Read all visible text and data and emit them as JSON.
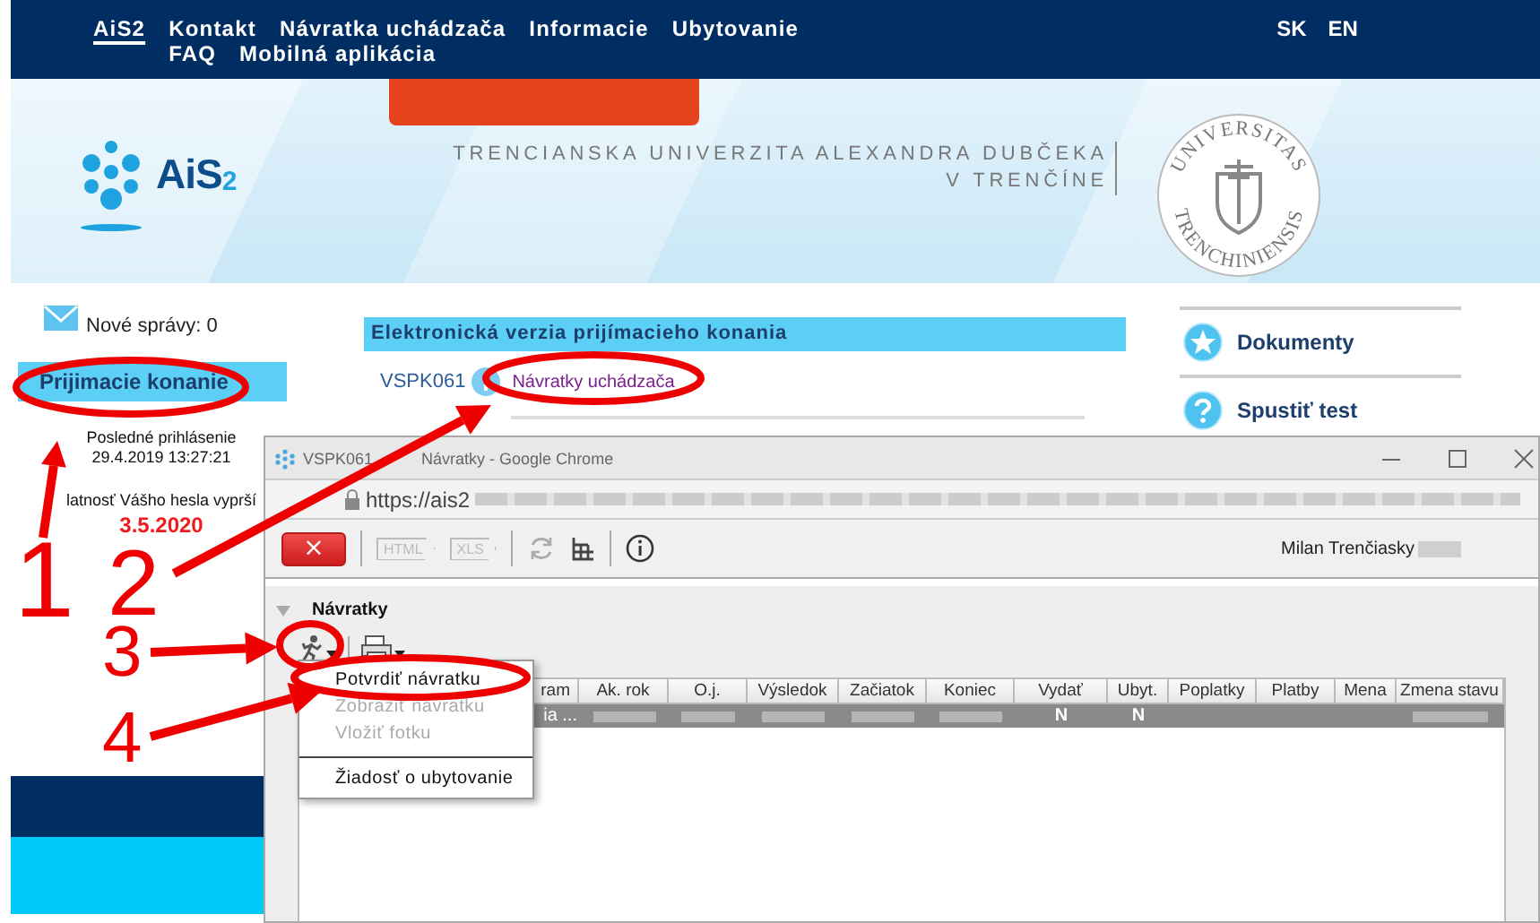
{
  "top_nav": {
    "items": [
      {
        "label": "AiS2",
        "selected": true
      },
      {
        "label": "Kontakt",
        "selected": false
      },
      {
        "label": "Návratka uchádzača",
        "selected": false
      },
      {
        "label": "Informacie",
        "selected": false
      },
      {
        "label": "Ubytovanie",
        "selected": false
      },
      {
        "label": "FAQ",
        "selected": false
      },
      {
        "label": "Mobilná aplikácia",
        "selected": false
      }
    ],
    "languages": [
      "SK",
      "EN"
    ]
  },
  "banner": {
    "logo_text": "AiS$_{2}$",
    "university_name": [
      "TRENCIANSKA UNIVERZITA ALEXANDRA DUBČEKA",
      "V TRENČÍNE"
    ],
    "seal_text": [
      "UNIVERSITAS",
      "TRENCHINIENSIS"
    ]
  },
  "sidebar": {
    "messages": "Nové správy: 0",
    "menu_items": [
      {
        "label": "Prijimacie konanie",
        "selected": true
      }
    ],
    "last_login_label": "Posledné prihlásenie",
    "last_login": "29.4.2019 13:27:21",
    "password_expiry_label": "latnosť Vášho hesla vyprší",
    "password_expiry_date": "3.5.2020"
  },
  "main": {
    "section_title": "Elektronická verzia prijímacieho konania",
    "code": "VSPK061",
    "link": "Návratky uchádzača"
  },
  "quick_links": [
    {
      "kind": "star",
      "label": "Dokumenty"
    },
    {
      "kind": "question",
      "label": "Spustiť test"
    }
  ],
  "popup_window": {
    "title_parts": [
      "VSPK061",
      "Návratky - Google Chrome"
    ],
    "url": "https://ais2",
    "close_label": "×",
    "export_buttons": [
      {
        "label": "HTML",
        "disabled": true
      },
      {
        "label": "XLS",
        "disabled": true
      }
    ],
    "user": "Milan Trenčiasky",
    "panel_title": "Návratky",
    "table": {
      "columns": [
        "ram",
        "Ak. rok",
        "O.j.",
        "Výsledok",
        "Začiatok",
        "Koniec",
        "Vydať",
        "Ubyt.",
        "Poplatky",
        "Platby",
        "Mena",
        "Zmena stavu"
      ],
      "rows": [
        {
          "selected": true,
          "cells": [
            {
              "kind": "text",
              "text": "ia ..."
            },
            {
              "kind": "blurred"
            },
            {
              "kind": "blurred"
            },
            {
              "kind": "blurred"
            },
            {
              "kind": "blurred"
            },
            {
              "kind": "blurred"
            },
            {
              "kind": "text",
              "text": "N"
            },
            {
              "kind": "text",
              "text": "N"
            },
            {
              "kind": "empty"
            },
            {
              "kind": "empty"
            },
            {
              "kind": "empty"
            },
            {
              "kind": "blurred"
            }
          ]
        }
      ]
    },
    "menu": {
      "items": [
        {
          "kind": "item",
          "label": "Potvrdiť návratku",
          "disabled": false
        },
        {
          "kind": "item",
          "label": "Zobraziť návratku",
          "disabled": true
        },
        {
          "kind": "item",
          "label": "Vložiť fotku",
          "disabled": true
        },
        {
          "kind": "separator"
        },
        {
          "kind": "item",
          "label": "Žiadosť o ubytovanie",
          "disabled": false
        }
      ]
    }
  },
  "annotations": [
    {
      "label": "1"
    },
    {
      "label": "2"
    },
    {
      "label": "3"
    },
    {
      "label": "4"
    }
  ]
}
